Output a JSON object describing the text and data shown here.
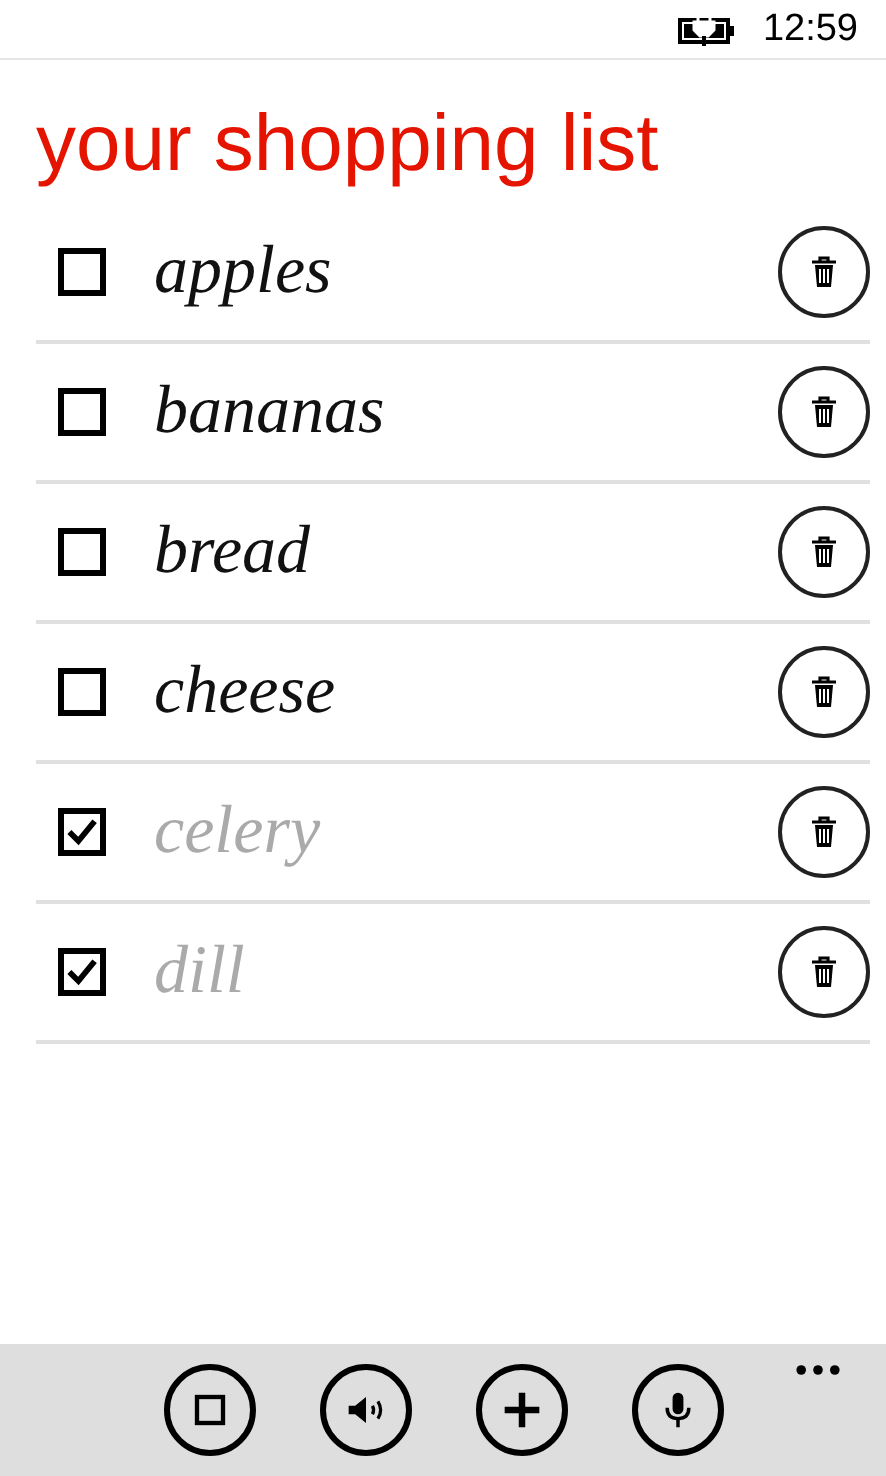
{
  "status_bar": {
    "time": "12:59"
  },
  "title": "your shopping list",
  "items": [
    {
      "name": "apples",
      "checked": false
    },
    {
      "name": "bananas",
      "checked": false
    },
    {
      "name": "bread",
      "checked": false
    },
    {
      "name": "cheese",
      "checked": false
    },
    {
      "name": "celery",
      "checked": true
    },
    {
      "name": "dill",
      "checked": true
    }
  ],
  "app_bar": {
    "buttons": [
      {
        "kind": "select"
      },
      {
        "kind": "speaker"
      },
      {
        "kind": "add"
      },
      {
        "kind": "mic"
      }
    ]
  }
}
